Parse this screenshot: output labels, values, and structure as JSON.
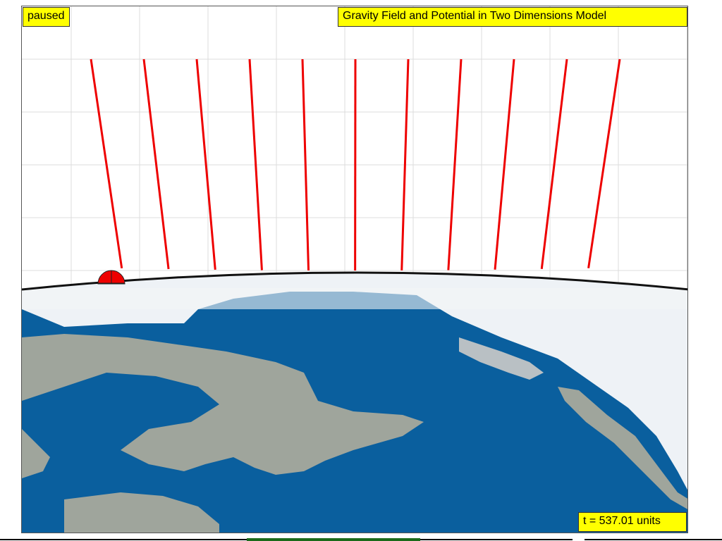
{
  "simulation": {
    "status": "paused",
    "title": "Gravity Field and Potential in Two Dimensions Model",
    "time_readout": "t = 537.01 units"
  },
  "field_vectors": {
    "count": 11,
    "color": "#ee0000"
  },
  "colors": {
    "ocean": "#0a5f9e",
    "land": "#9fa59c",
    "ice": "#eef2f6",
    "label_background": "#ffff00",
    "mass_marker": "#ee0000",
    "progress": "#1a6b1a"
  },
  "controls": {
    "progress_fraction": 0.3
  }
}
